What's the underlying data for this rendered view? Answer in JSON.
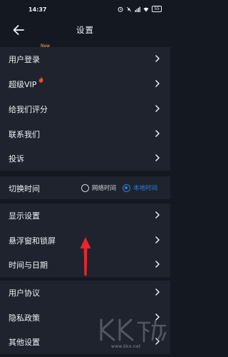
{
  "status_bar": {
    "time": "14:37",
    "battery": "55"
  },
  "header": {
    "title": "设置"
  },
  "group1": [
    {
      "label": "用户登录",
      "badge": "New"
    },
    {
      "label": "超级VIP"
    },
    {
      "label": "给我们评分"
    },
    {
      "label": "联系我们"
    },
    {
      "label": "投诉"
    }
  ],
  "time_switch": {
    "label": "切换时间",
    "options": [
      "网络时间",
      "本地时间"
    ],
    "selected": "本地时间"
  },
  "group2": [
    {
      "label": "显示设置"
    },
    {
      "label": "悬浮窗和锁屏"
    },
    {
      "label": "时间与日期"
    }
  ],
  "group3": [
    {
      "label": "用户协议"
    },
    {
      "label": "隐私政策"
    },
    {
      "label": "其他设置"
    }
  ],
  "watermark": {
    "url": "www.kkx.net",
    "logo": "KK下载"
  },
  "colors": {
    "background": "#141821",
    "row": "#1e232d",
    "accent": "#2f7fe6",
    "badge": "#ffb23f",
    "arrow": "#e8262b"
  }
}
